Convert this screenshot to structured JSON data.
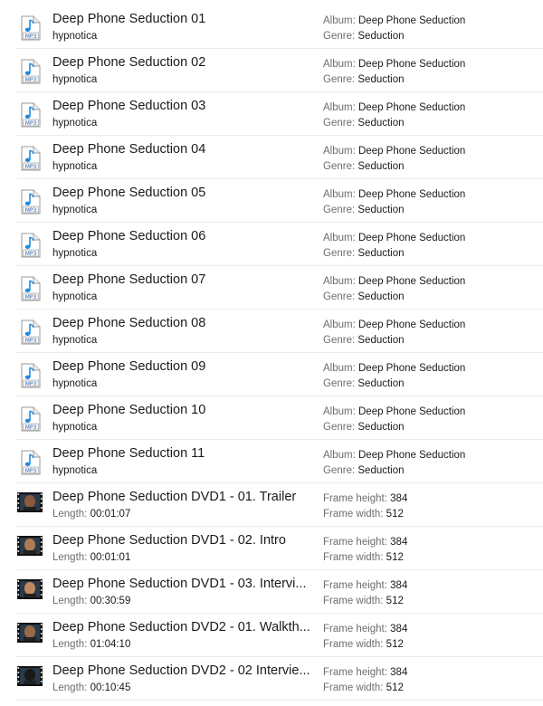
{
  "labels": {
    "album": "Album:",
    "genre": "Genre:",
    "length": "Length:",
    "frame_height": "Frame height:",
    "frame_width": "Frame width:"
  },
  "files": [
    {
      "type": "audio",
      "icon": "mp3-file-icon",
      "icon_text": "MP3",
      "title": "Deep Phone Seduction 01",
      "artist": "hypnotica",
      "album": "Deep Phone Seduction",
      "genre": "Seduction"
    },
    {
      "type": "audio",
      "icon": "mp3-file-icon",
      "icon_text": "MP3",
      "title": "Deep Phone Seduction 02",
      "artist": "hypnotica",
      "album": "Deep Phone Seduction",
      "genre": "Seduction"
    },
    {
      "type": "audio",
      "icon": "mp3-file-icon",
      "icon_text": "MP3",
      "title": "Deep Phone Seduction 03",
      "artist": "hypnotica",
      "album": "Deep Phone Seduction",
      "genre": "Seduction"
    },
    {
      "type": "audio",
      "icon": "mp3-file-icon",
      "icon_text": "MP3",
      "title": "Deep Phone Seduction 04",
      "artist": "hypnotica",
      "album": "Deep Phone Seduction",
      "genre": "Seduction"
    },
    {
      "type": "audio",
      "icon": "mp3-file-icon",
      "icon_text": "MP3",
      "title": "Deep Phone Seduction 05",
      "artist": "hypnotica",
      "album": "Deep Phone Seduction",
      "genre": "Seduction"
    },
    {
      "type": "audio",
      "icon": "mp3-file-icon",
      "icon_text": "MP3",
      "title": "Deep Phone Seduction 06",
      "artist": "hypnotica",
      "album": "Deep Phone Seduction",
      "genre": "Seduction"
    },
    {
      "type": "audio",
      "icon": "mp3-file-icon",
      "icon_text": "MP3",
      "title": "Deep Phone Seduction 07",
      "artist": "hypnotica",
      "album": "Deep Phone Seduction",
      "genre": "Seduction"
    },
    {
      "type": "audio",
      "icon": "mp3-file-icon",
      "icon_text": "MP3",
      "title": "Deep Phone Seduction 08",
      "artist": "hypnotica",
      "album": "Deep Phone Seduction",
      "genre": "Seduction"
    },
    {
      "type": "audio",
      "icon": "mp3-file-icon",
      "icon_text": "MP3",
      "title": "Deep Phone Seduction 09",
      "artist": "hypnotica",
      "album": "Deep Phone Seduction",
      "genre": "Seduction"
    },
    {
      "type": "audio",
      "icon": "mp3-file-icon",
      "icon_text": "MP3",
      "title": "Deep Phone Seduction 10",
      "artist": "hypnotica",
      "album": "Deep Phone Seduction",
      "genre": "Seduction"
    },
    {
      "type": "audio",
      "icon": "mp3-file-icon",
      "icon_text": "MP3",
      "title": "Deep Phone Seduction 11",
      "artist": "hypnotica",
      "album": "Deep Phone Seduction",
      "genre": "Seduction"
    },
    {
      "type": "video",
      "icon": "video-thumbnail-icon",
      "title": "Deep Phone Seduction DVD1 - 01. Trailer",
      "length": "00:01:07",
      "frame_height": "384",
      "frame_width": "512"
    },
    {
      "type": "video",
      "icon": "video-thumbnail-icon",
      "title": "Deep Phone Seduction DVD1 - 02. Intro",
      "length": "00:01:01",
      "frame_height": "384",
      "frame_width": "512"
    },
    {
      "type": "video",
      "icon": "video-thumbnail-icon",
      "title": "Deep Phone Seduction DVD1 - 03. Intervi...",
      "length": "00:30:59",
      "frame_height": "384",
      "frame_width": "512"
    },
    {
      "type": "video",
      "icon": "video-thumbnail-icon",
      "title": "Deep Phone Seduction DVD2 - 01. Walkth...",
      "length": "01:04:10",
      "frame_height": "384",
      "frame_width": "512"
    },
    {
      "type": "video",
      "icon": "video-thumbnail-icon",
      "title": "Deep Phone Seduction DVD2 - 02 Intervie...",
      "length": "00:10:45",
      "frame_height": "384",
      "frame_width": "512"
    }
  ],
  "colors": {
    "note_blue": "#1e8be0",
    "separator": "#ececec",
    "key_gray": "#6d6d6d"
  }
}
